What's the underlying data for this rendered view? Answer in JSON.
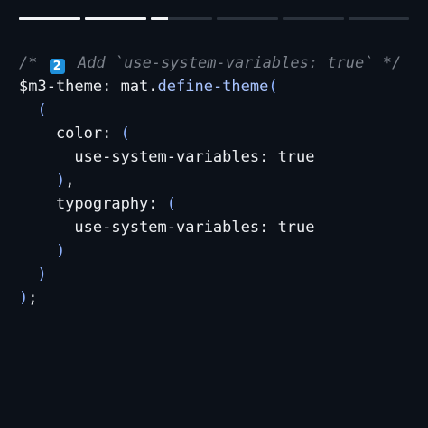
{
  "colors": {
    "background": "#0c1119",
    "progress_track": "#2b323c",
    "progress_fill": "#f2f3f5",
    "text": "#eceef1",
    "comment": "#7c828b",
    "function": "#a9c4ff",
    "paren": "#8fb3ff",
    "emoji_badge": "#1f8fd9"
  },
  "story_progress": {
    "segments": [
      {
        "fill": 1.0
      },
      {
        "fill": 1.0
      },
      {
        "fill": 0.28
      },
      {
        "fill": 0.0
      },
      {
        "fill": 0.0
      },
      {
        "fill": 0.0
      }
    ]
  },
  "code": {
    "lines": [
      {
        "tokens": [
          {
            "text": "/* ",
            "kind": "comment"
          },
          {
            "text": "2",
            "kind": "emoji",
            "icon": "keycap-digit-two-icon"
          },
          {
            "text": " Add `use-system-variables: true` */",
            "kind": "comment"
          }
        ]
      },
      {
        "tokens": [
          {
            "text": "$m3-theme: mat.",
            "kind": "plain"
          },
          {
            "text": "define-theme",
            "kind": "func"
          },
          {
            "text": "(",
            "kind": "paren"
          }
        ]
      },
      {
        "tokens": [
          {
            "text": "  ",
            "kind": "plain"
          },
          {
            "text": "(",
            "kind": "paren"
          }
        ]
      },
      {
        "tokens": [
          {
            "text": "    color: ",
            "kind": "plain"
          },
          {
            "text": "(",
            "kind": "paren"
          }
        ]
      },
      {
        "tokens": [
          {
            "text": "      use-system-variables: true",
            "kind": "plain"
          }
        ]
      },
      {
        "tokens": [
          {
            "text": "    ",
            "kind": "plain"
          },
          {
            "text": ")",
            "kind": "paren"
          },
          {
            "text": ",",
            "kind": "punct"
          }
        ]
      },
      {
        "tokens": [
          {
            "text": "    typography: ",
            "kind": "plain"
          },
          {
            "text": "(",
            "kind": "paren"
          }
        ]
      },
      {
        "tokens": [
          {
            "text": "      use-system-variables: true",
            "kind": "plain"
          }
        ]
      },
      {
        "tokens": [
          {
            "text": "    ",
            "kind": "plain"
          },
          {
            "text": ")",
            "kind": "paren"
          }
        ]
      },
      {
        "tokens": [
          {
            "text": "  ",
            "kind": "plain"
          },
          {
            "text": ")",
            "kind": "paren"
          }
        ]
      },
      {
        "tokens": [
          {
            "text": ")",
            "kind": "paren"
          },
          {
            "text": ";",
            "kind": "punct"
          }
        ]
      }
    ]
  }
}
